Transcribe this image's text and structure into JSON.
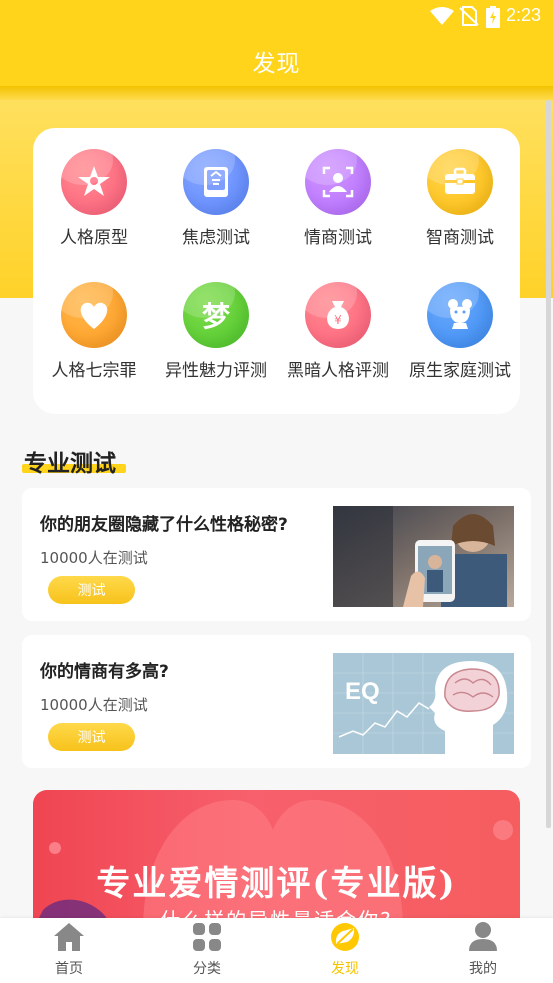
{
  "status_bar": {
    "time": "2:23"
  },
  "header": {
    "title": "发现"
  },
  "categories": [
    {
      "label": "人格原型",
      "icon": "star-person-icon",
      "color_a": "#ff5f7d",
      "color_b": "#ff8a8f"
    },
    {
      "label": "焦虑测试",
      "icon": "book-icon",
      "color_a": "#5b86ff",
      "color_b": "#86a6ff"
    },
    {
      "label": "情商测试",
      "icon": "face-frame-icon",
      "color_a": "#b46bff",
      "color_b": "#cf95ff"
    },
    {
      "label": "智商测试",
      "icon": "briefcase-icon",
      "color_a": "#ffbe0d",
      "color_b": "#ffd44d"
    },
    {
      "label": "人格七宗罪",
      "icon": "heart-icon",
      "color_a": "#ff9a1e",
      "color_b": "#ffb84d"
    },
    {
      "label": "异性魅力评测",
      "icon": "dream-glyph-icon",
      "glyph": "梦",
      "color_a": "#4ec92b",
      "color_b": "#7fdb4b"
    },
    {
      "label": "黑暗人格评测",
      "icon": "money-bag-icon",
      "color_a": "#ff5f7d",
      "color_b": "#ff8a8f"
    },
    {
      "label": "原生家庭测试",
      "icon": "mouse-icon",
      "color_a": "#3b8cf5",
      "color_b": "#6aa9fb"
    }
  ],
  "section": {
    "title": "专业测试"
  },
  "tests": [
    {
      "title": "你的朋友圈隐藏了什么性格秘密?",
      "count": "10000人在测试",
      "button": "测试",
      "image": "phone-photo-image"
    },
    {
      "title": "你的情商有多高?",
      "count": "10000人在测试",
      "button": "测试",
      "image": "eq-brain-image",
      "image_text": "EQ"
    }
  ],
  "banner": {
    "title": "专业爱情测评(专业版)",
    "subtitle": "什么样的异性最适合你?"
  },
  "bottom_nav": [
    {
      "label": "首页",
      "icon": "home-icon",
      "active": false
    },
    {
      "label": "分类",
      "icon": "grid-icon",
      "active": false
    },
    {
      "label": "发现",
      "icon": "discover-icon",
      "active": true
    },
    {
      "label": "我的",
      "icon": "user-icon",
      "active": false
    }
  ],
  "colors": {
    "accent": "#ffd41a",
    "active_nav": "#f5c400",
    "banner": "#f04552"
  }
}
